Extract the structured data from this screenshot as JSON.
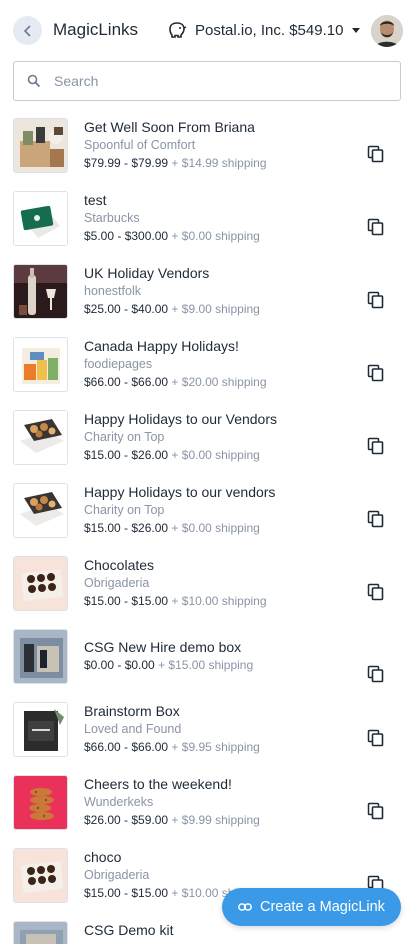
{
  "header": {
    "title": "MagicLinks",
    "account": "Postal.io, Inc. $549.10"
  },
  "search": {
    "placeholder": "Search"
  },
  "items": [
    {
      "name": "Get Well Soon From Briana",
      "vendor": "Spoonful of Comfort",
      "price": "$79.99 - $79.99",
      "shipping": "+ $14.99 shipping",
      "thumb": "gift-basket"
    },
    {
      "name": "test",
      "vendor": "Starbucks",
      "price": "$5.00 - $300.00",
      "shipping": "+ $0.00 shipping",
      "thumb": "gift-card"
    },
    {
      "name": "UK Holiday Vendors",
      "vendor": "honestfolk",
      "price": "$25.00 - $40.00",
      "shipping": "+ $9.00 shipping",
      "thumb": "wine-bottle"
    },
    {
      "name": "Canada Happy Holidays!",
      "vendor": "foodiepages",
      "price": "$66.00 - $66.00",
      "shipping": "+ $20.00 shipping",
      "thumb": "snack-box"
    },
    {
      "name": "Happy Holidays to our Vendors",
      "vendor": "Charity on Top",
      "price": "$15.00 - $26.00",
      "shipping": "+ $0.00 shipping",
      "thumb": "cookie-box"
    },
    {
      "name": "Happy Holidays to our vendors",
      "vendor": "Charity on Top",
      "price": "$15.00 - $26.00",
      "shipping": "+ $0.00 shipping",
      "thumb": "cookie-box"
    },
    {
      "name": "Chocolates",
      "vendor": "Obrigaderia",
      "price": "$15.00 - $15.00",
      "shipping": "+ $10.00 shipping",
      "thumb": "chocolate-box"
    },
    {
      "name": "CSG New Hire demo box",
      "vendor": "",
      "price": "$0.00 - $0.00",
      "shipping": "+ $15.00 shipping",
      "thumb": "demo-box"
    },
    {
      "name": "Brainstorm Box",
      "vendor": "Loved and Found",
      "price": "$66.00 - $66.00",
      "shipping": "+ $9.95 shipping",
      "thumb": "brainstorm-box"
    },
    {
      "name": "Cheers to the weekend!",
      "vendor": "Wunderkeks",
      "price": "$26.00 - $59.00",
      "shipping": "+ $9.99 shipping",
      "thumb": "cookie-stack"
    },
    {
      "name": "choco",
      "vendor": "Obrigaderia",
      "price": "$15.00 - $15.00",
      "shipping": "+ $10.00 shipping",
      "thumb": "chocolate-box"
    },
    {
      "name": "CSG Demo kit",
      "vendor": "",
      "price": "",
      "shipping": "",
      "thumb": "demo-kit"
    }
  ],
  "fab": {
    "label": "Create a MagicLink"
  },
  "colors": {
    "accent": "#3b9ae8",
    "muted": "#8a94a6",
    "text": "#1f2a37"
  }
}
